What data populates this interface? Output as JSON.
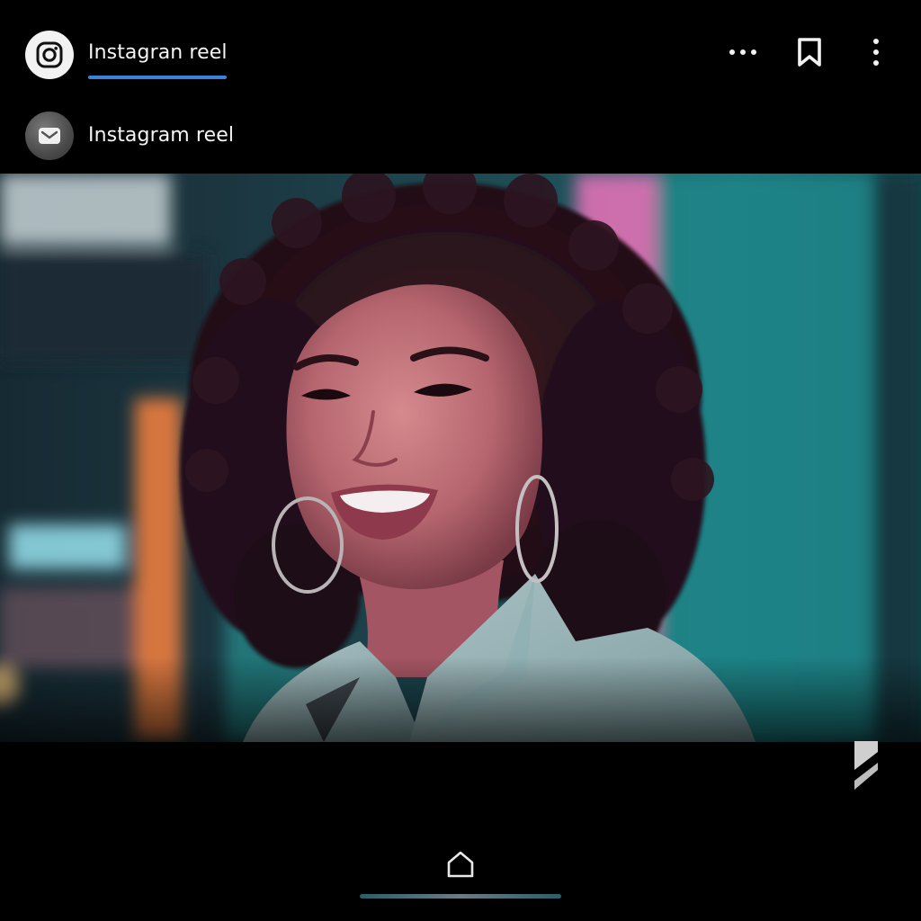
{
  "header": {
    "primary_account": {
      "label": "Instagran reel",
      "icon": "instagram-icon",
      "active": true
    },
    "secondary_account": {
      "label": "Instagram reel",
      "icon": "mail-icon"
    },
    "actions": [
      {
        "icon": "more-horizontal-icon"
      },
      {
        "icon": "bookmark-icon"
      },
      {
        "icon": "more-vertical-icon"
      }
    ]
  },
  "media": {
    "kind": "reel-video-frame"
  },
  "bottom_nav": {
    "home_icon": "home-icon"
  },
  "colors": {
    "background": "#000000",
    "accent_underline": "#3a82d8",
    "text": "#f5f5f5"
  }
}
